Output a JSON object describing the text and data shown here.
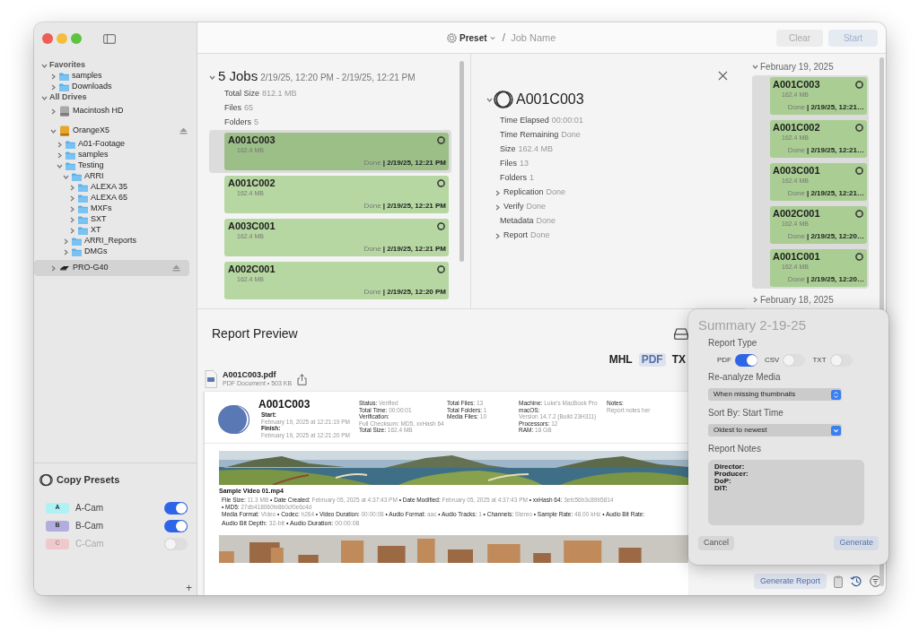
{
  "sidebar": {
    "sections": [
      {
        "label": "Favorites",
        "expanded": true,
        "items": [
          {
            "label": "samples",
            "kind": "folder",
            "expanded": false,
            "selected": false
          },
          {
            "label": "Downloads",
            "kind": "folder",
            "expanded": false,
            "selected": false
          }
        ]
      },
      {
        "label": "All Drives",
        "expanded": true,
        "items": [
          {
            "label": "Macintosh HD",
            "kind": "disk",
            "expanded": false,
            "selected": false
          },
          {
            "label": "OrangeX5",
            "kind": "drive",
            "expanded": true,
            "selected": false,
            "ejectable": true,
            "children": [
              {
                "label": "A01-Footage",
                "kind": "folder",
                "expanded": false,
                "selected": false
              },
              {
                "label": "samples",
                "kind": "folder",
                "expanded": false,
                "selected": false
              },
              {
                "label": "Testing",
                "kind": "folder",
                "expanded": true,
                "selected": false,
                "children": [
                  {
                    "label": "ARRI",
                    "kind": "folder",
                    "expanded": true,
                    "selected": false,
                    "children": [
                      {
                        "label": "ALEXA 35",
                        "kind": "folder",
                        "expanded": false,
                        "selected": false
                      },
                      {
                        "label": "ALEXA 65",
                        "kind": "folder",
                        "expanded": false,
                        "selected": false
                      },
                      {
                        "label": "MXFs",
                        "kind": "folder",
                        "expanded": false,
                        "selected": false
                      },
                      {
                        "label": "SXT",
                        "kind": "folder",
                        "expanded": false,
                        "selected": false
                      },
                      {
                        "label": "XT",
                        "kind": "folder",
                        "expanded": false,
                        "selected": false
                      }
                    ]
                  },
                  {
                    "label": "ARRI_Reports",
                    "kind": "folder",
                    "expanded": false,
                    "selected": false
                  },
                  {
                    "label": "DMGs",
                    "kind": "folder",
                    "expanded": false,
                    "selected": false
                  }
                ]
              }
            ]
          },
          {
            "label": "PRO-G40",
            "kind": "ssd",
            "expanded": false,
            "selected": true,
            "ejectable": true
          }
        ]
      }
    ],
    "presets": {
      "title": "Copy Presets",
      "items": [
        {
          "letter": "A",
          "label": "A-Cam",
          "color": "#aef2f4",
          "on": true
        },
        {
          "letter": "B",
          "label": "B-Cam",
          "color": "#b3acdf",
          "on": true
        },
        {
          "letter": "C",
          "label": "C-Cam",
          "color": "#f1c9cd",
          "on": false
        }
      ],
      "add": "+"
    }
  },
  "toolbar": {
    "preset": "Preset",
    "separator": "/",
    "job_name_placeholder": "Job Name",
    "buttons": [
      {
        "label": "Clear",
        "kind": "clear",
        "disabled": true
      },
      {
        "label": "Start",
        "kind": "start",
        "disabled": true
      }
    ]
  },
  "jobs": {
    "expanded": true,
    "title": "5 Jobs",
    "range": "2/19/25, 12:20 PM - 2/19/25, 12:21 PM",
    "stats": [
      {
        "label": "Total Size",
        "value": "812.1 MB"
      },
      {
        "label": "Files",
        "value": "65"
      },
      {
        "label": "Folders",
        "value": "5"
      }
    ],
    "items": [
      {
        "name": "A001C003",
        "size": "162.4 MB",
        "status": "Done",
        "time": "| 2/19/25, 12:21 PM",
        "selected": true
      },
      {
        "name": "A001C002",
        "size": "162.4 MB",
        "status": "Done",
        "time": "| 2/19/25, 12:21 PM",
        "selected": false
      },
      {
        "name": "A003C001",
        "size": "162.4 MB",
        "status": "Done",
        "time": "| 2/19/25, 12:21 PM",
        "selected": false
      },
      {
        "name": "A002C001",
        "size": "162.4 MB",
        "status": "Done",
        "time": "| 2/19/25, 12:20 PM",
        "selected": false
      }
    ]
  },
  "detail": {
    "expanded": true,
    "title": "A001C003",
    "rows": [
      {
        "kind": "stat",
        "label": "Time Elapsed",
        "value": "00:00:01"
      },
      {
        "kind": "stat",
        "label": "Time Remaining",
        "value": "Done"
      },
      {
        "kind": "stat",
        "label": "Size",
        "value": "162.4 MB"
      },
      {
        "kind": "stat",
        "label": "Files",
        "value": "13"
      },
      {
        "kind": "stat",
        "label": "Folders",
        "value": "1"
      },
      {
        "kind": "group",
        "label": "Replication",
        "value": "Done",
        "expanded": false
      },
      {
        "kind": "group",
        "label": "Verify",
        "value": "Done",
        "expanded": false
      },
      {
        "kind": "stat",
        "label": "Metadata",
        "value": "Done"
      },
      {
        "kind": "group",
        "label": "Report",
        "value": "Done",
        "expanded": false
      }
    ]
  },
  "history": {
    "groups": [
      {
        "date": "February 19, 2025",
        "expanded": true,
        "jobs": [
          {
            "name": "A001C003",
            "size": "162.4 MB",
            "status": "Done",
            "time": "| 2/19/25, 12:21…",
            "selected": true
          },
          {
            "name": "A001C002",
            "size": "162.4 MB",
            "status": "Done",
            "time": "| 2/19/25, 12:21…",
            "selected": true
          },
          {
            "name": "A003C001",
            "size": "162.4 MB",
            "status": "Done",
            "time": "| 2/19/25, 12:21…",
            "selected": true
          },
          {
            "name": "A002C001",
            "size": "162.4 MB",
            "status": "Done",
            "time": "| 2/19/25, 12:20…",
            "selected": true
          },
          {
            "name": "A001C001",
            "size": "162.4 MB",
            "status": "Done",
            "time": "| 2/19/25, 12:20…",
            "selected": true
          }
        ]
      },
      {
        "date": "February 18, 2025",
        "expanded": false
      }
    ],
    "generate_button": "Generate Report"
  },
  "report_preview": {
    "title": "Report Preview",
    "formats": [
      {
        "label": "MHL",
        "selected": false
      },
      {
        "label": "PDF",
        "selected": true
      },
      {
        "label": "TX",
        "selected": false
      }
    ],
    "file": {
      "name": "A001C003.pdf",
      "meta": "PDF Document • 503 KB"
    },
    "report": {
      "title": "A001C003",
      "times": [
        {
          "label": "Start:",
          "value": "February 19, 2025 at 12:21:19 PM"
        },
        {
          "label": "Finish:",
          "value": "February 19, 2025 at 12:21:20 PM"
        }
      ],
      "columns": [
        [
          {
            "label": "Status:",
            "value": "Verified"
          },
          {
            "label": "Total Time:",
            "value": "00:00:01"
          },
          {
            "label": "Verification:",
            "value": "Full Checksum: MD5, xxHash 64"
          },
          {
            "label": "Total Size:",
            "value": "162.4 MB"
          }
        ],
        [
          {
            "label": "Total Files:",
            "value": "13"
          },
          {
            "label": "Total Folders:",
            "value": "1"
          },
          {
            "label": "Media Files:",
            "value": "10"
          }
        ],
        [
          {
            "label": "Machine:",
            "value": "Luke's MacBook Pro"
          },
          {
            "label": "macOS:",
            "value": "Version 14.7.2 (Build 23H311)"
          },
          {
            "label": "Processors:",
            "value": "12"
          },
          {
            "label": "RAM:",
            "value": "18 GB"
          }
        ],
        [
          {
            "label": "Notes:"
          },
          {
            "value": "Report notes her"
          }
        ]
      ],
      "separator": "•",
      "clips": [
        {
          "kind": "landscape",
          "name": "Sample Video 01.mp4",
          "lines": [
            [
              {
                "label": "File Size:",
                "value": "11.3 MB"
              },
              {
                "label": "Date Created:",
                "value": "February 05, 2025 at 4:37:43 PM"
              },
              {
                "label": "Date Modified:",
                "value": "February 05, 2025 at 4:37:43 PM"
              },
              {
                "label": "xxHash 64:",
                "value": "3efc56b3c89b5814"
              },
              {
                "label": "MD5:",
                "value": "27db418060fe8b0cf0e6c4d"
              }
            ],
            [
              {
                "label": "Media Format:",
                "value": "Video"
              },
              {
                "label": "Codec:",
                "value": "h264"
              },
              {
                "label": "Video Duration:",
                "value": "00:00:08"
              },
              {
                "label": "Audio Format:",
                "value": "aac"
              },
              {
                "label": "Audio Tracks:",
                "value": "1"
              },
              {
                "label": "Channels:",
                "value": "Stereo"
              },
              {
                "label": "Sample Rate:",
                "value": "48.00 kHz"
              },
              {
                "label": "Audio Bit Rate:"
              }
            ],
            [
              {
                "label": "Audio Bit Depth:",
                "value": "32-bit"
              },
              {
                "label": "Audio Duration:",
                "value": "00:00:08"
              }
            ]
          ]
        },
        {
          "kind": "city"
        }
      ]
    }
  },
  "summary_popover": {
    "title": "Summary 2-19-25",
    "report_type_label": "Report Type",
    "report_types": [
      {
        "label": "PDF",
        "on": true
      },
      {
        "label": "CSV",
        "on": false
      },
      {
        "label": "TXT",
        "on": false
      }
    ],
    "reanalyze": {
      "label": "Re-analyze Media",
      "value": "When missing thumbnails",
      "kind": "stepper"
    },
    "sort": {
      "label": "Sort By: Start Time",
      "value": "Oldest to newest",
      "kind": "menu"
    },
    "notes": {
      "label": "Report Notes",
      "value": "Director:\nProducer:\nDoP:\nDIT:"
    },
    "buttons": [
      {
        "label": "Cancel",
        "kind": "cancel"
      },
      {
        "label": "Generate",
        "kind": "default"
      }
    ]
  }
}
